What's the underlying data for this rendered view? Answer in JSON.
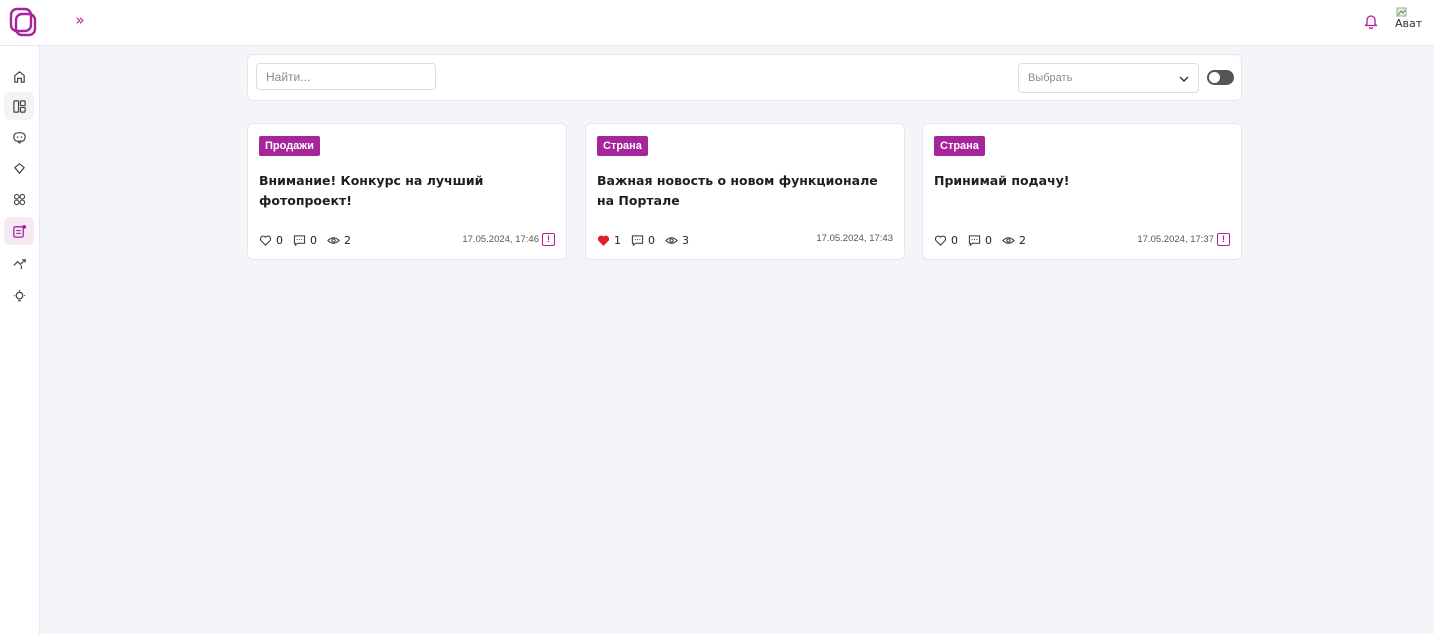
{
  "header": {
    "expand_label": "»",
    "avatar_alt": "Ават"
  },
  "toolbar": {
    "search_placeholder": "Найти...",
    "select_value": "Выбрать"
  },
  "colors": {
    "accent": "#a6259a",
    "liked": "#e0202c"
  },
  "sidebar": {
    "items": [
      {
        "icon": "home-icon"
      },
      {
        "icon": "dashboard-icon"
      },
      {
        "icon": "chat-icon"
      },
      {
        "icon": "tag-icon"
      },
      {
        "icon": "apps-icon"
      },
      {
        "icon": "news-icon"
      },
      {
        "icon": "analytics-icon"
      },
      {
        "icon": "idea-icon"
      }
    ]
  },
  "cards": [
    {
      "tag": "Продажи",
      "title": "Внимание! Конкурс на лучший фотопроект!",
      "likes": "0",
      "comments": "0",
      "views": "2",
      "date": "17.05.2024, 17:46",
      "liked": false,
      "flag": "!"
    },
    {
      "tag": "Страна",
      "title": "Важная новость о новом функционале на Портале",
      "likes": "1",
      "comments": "0",
      "views": "3",
      "date": "17.05.2024, 17:43",
      "liked": true,
      "flag": ""
    },
    {
      "tag": "Страна",
      "title": "Принимай подачу!",
      "likes": "0",
      "comments": "0",
      "views": "2",
      "date": "17.05.2024, 17:37",
      "liked": false,
      "flag": "!"
    }
  ]
}
